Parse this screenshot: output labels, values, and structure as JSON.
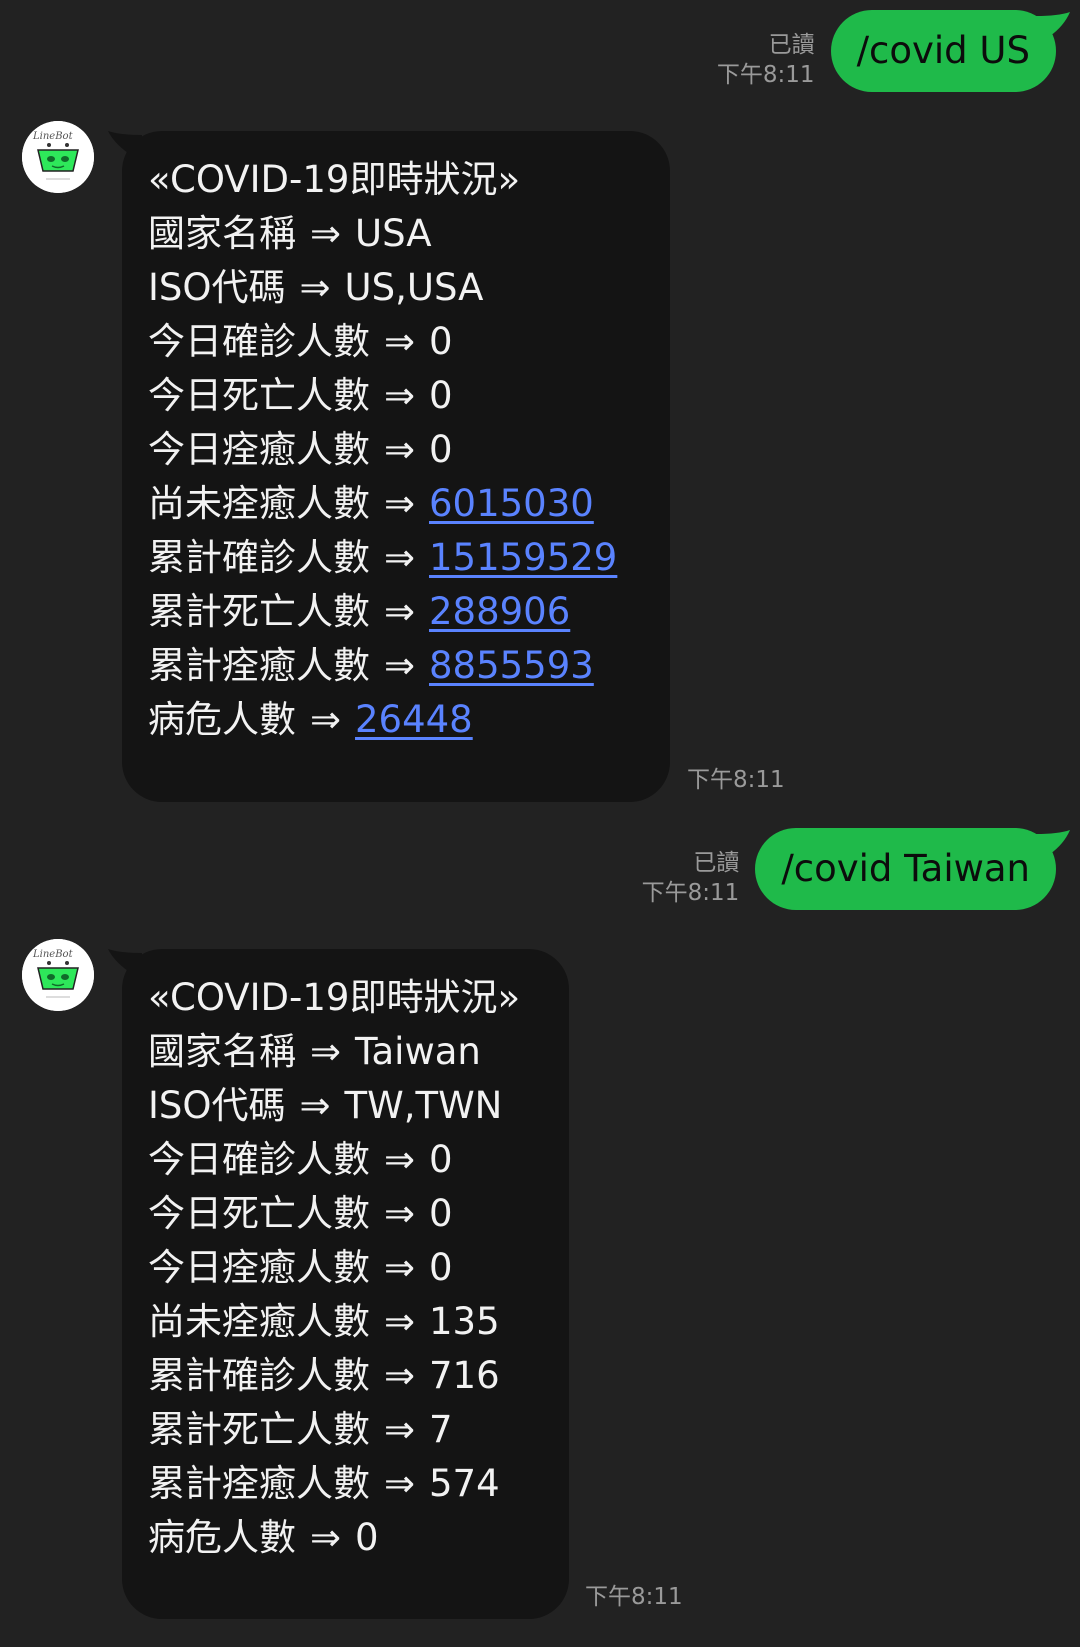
{
  "colors": {
    "background": "#222222",
    "outgoing_bubble": "#1fba4a",
    "incoming_bubble": "#141414",
    "link": "#5a83ff",
    "meta_text": "#9a9a9a"
  },
  "messages": [
    {
      "type": "outgoing",
      "text": "/covid US",
      "read_label": "已讀",
      "time": "下午8:11"
    },
    {
      "type": "incoming",
      "avatar_icon": "linebot-avatar-icon",
      "time": "下午8:11",
      "title": "«COVID-19即時狀況»",
      "arrow": "⇒",
      "rows": [
        {
          "label": "國家名稱",
          "value": "USA",
          "link": false
        },
        {
          "label": "ISO代碼",
          "value": "US,USA",
          "link": false
        },
        {
          "label": "今日確診人數",
          "value": "0",
          "link": false
        },
        {
          "label": "今日死亡人數",
          "value": "0",
          "link": false
        },
        {
          "label": "今日痊癒人數",
          "value": "0",
          "link": false
        },
        {
          "label": "尚未痊癒人數",
          "value": "6015030",
          "link": true
        },
        {
          "label": "累計確診人數",
          "value": "15159529",
          "link": true
        },
        {
          "label": "累計死亡人數",
          "value": "288906",
          "link": true
        },
        {
          "label": "累計痊癒人數",
          "value": "8855593",
          "link": true
        },
        {
          "label": "病危人數",
          "value": "26448",
          "link": true
        }
      ]
    },
    {
      "type": "outgoing",
      "text": "/covid Taiwan",
      "read_label": "已讀",
      "time": "下午8:11"
    },
    {
      "type": "incoming",
      "avatar_icon": "linebot-avatar-icon",
      "time": "下午8:11",
      "title": "«COVID-19即時狀況»",
      "arrow": "⇒",
      "rows": [
        {
          "label": "國家名稱",
          "value": "Taiwan",
          "link": false
        },
        {
          "label": "ISO代碼",
          "value": "TW,TWN",
          "link": false
        },
        {
          "label": "今日確診人數",
          "value": "0",
          "link": false
        },
        {
          "label": "今日死亡人數",
          "value": "0",
          "link": false
        },
        {
          "label": "今日痊癒人數",
          "value": "0",
          "link": false
        },
        {
          "label": "尚未痊癒人數",
          "value": "135",
          "link": false
        },
        {
          "label": "累計確診人數",
          "value": "716",
          "link": false
        },
        {
          "label": "累計死亡人數",
          "value": "7",
          "link": false
        },
        {
          "label": "累計痊癒人數",
          "value": "574",
          "link": false
        },
        {
          "label": "病危人數",
          "value": "0",
          "link": false
        }
      ]
    }
  ]
}
